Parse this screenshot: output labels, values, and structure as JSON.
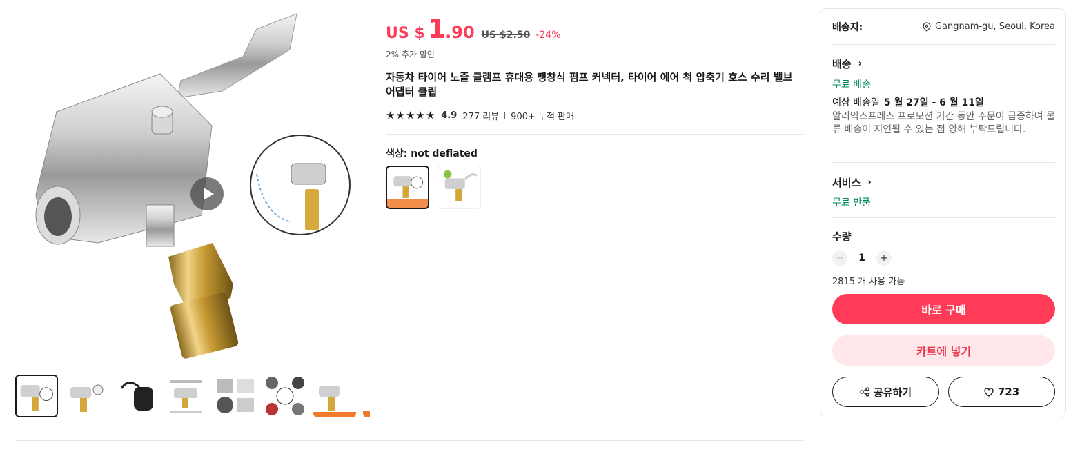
{
  "price": {
    "currency": "US $",
    "integer": "1",
    "decimal": ".90",
    "original": "US $2.50",
    "discount": "-24%",
    "extra_discount": "2% 추가 할인"
  },
  "product": {
    "title": "자동차 타이어 노즐 클램프 휴대용 팽창식 펌프 커넥터, 타이어 에어 척 압축기 호스 수리 밸브 어댑터 클립",
    "rating": "4.9",
    "reviews": "277 리뷰",
    "sold": "900+ 누적 판매",
    "stars": 5
  },
  "color": {
    "label": "색상",
    "selected": "not deflated"
  },
  "gallery": {
    "next_icon": "chevron-right-icon",
    "play_icon": "play-icon"
  },
  "panel": {
    "ship_to_label": "배송지:",
    "location": "Gangnam-gu, Seoul, Korea",
    "shipping_title": "배송",
    "free_shipping": "무료 배송",
    "eta_label": "예상 배송일",
    "eta_dates": "5 월 27일 - 6 월 11일",
    "note": "알리익스프레스 프로모션 기간 동안 주문이 급증하여 물류 배송이 지연될 수 있는 점 양해 부탁드립니다.",
    "service_title": "서비스",
    "free_return": "무료 반품",
    "qty_label": "수량",
    "qty_minus": "−",
    "qty_value": "1",
    "qty_plus": "+",
    "available": "2815 개 사용 가능",
    "buy_now": "바로 구매",
    "add_cart": "카트에 넣기",
    "share": "공유하기",
    "wishlist_count": "723"
  },
  "colors": {
    "accent": "#ff3b58",
    "green": "#00875a",
    "cart_bg": "#ffe7ea"
  }
}
